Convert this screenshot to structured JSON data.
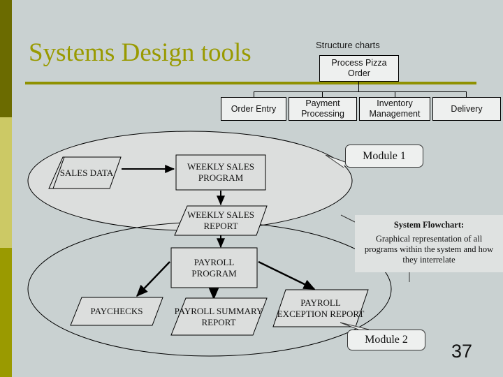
{
  "slide": {
    "title": "Systems Design tools",
    "page_number": "37",
    "background_color": "#c9d1d1",
    "title_color": "#999a00"
  },
  "sidebar": {
    "bands": [
      {
        "name": "top",
        "color": "#6b6b00"
      },
      {
        "name": "middle",
        "color": "#ccc965"
      },
      {
        "name": "bottom",
        "color": "#9a9a00"
      }
    ]
  },
  "structure_chart": {
    "label": "Structure charts",
    "root": "Process Pizza Order",
    "children": [
      {
        "label": "Order Entry"
      },
      {
        "label": "Payment Processing"
      },
      {
        "label": "Inventory Management"
      },
      {
        "label": "Delivery"
      }
    ]
  },
  "flowchart": {
    "nodes": [
      {
        "id": "sales-data",
        "shape": "parallelogram",
        "label": "SALES DATA"
      },
      {
        "id": "weekly-sales-program",
        "shape": "rectangle",
        "label": "WEEKLY SALES PROGRAM"
      },
      {
        "id": "weekly-sales-report",
        "shape": "parallelogram",
        "label": "WEEKLY SALES REPORT"
      },
      {
        "id": "payroll-program",
        "shape": "rectangle",
        "label": "PAYROLL PROGRAM"
      },
      {
        "id": "paychecks",
        "shape": "parallelogram",
        "label": "PAYCHECKS"
      },
      {
        "id": "payroll-summary-report",
        "shape": "parallelogram",
        "label": "PAYROLL SUMMARY REPORT"
      },
      {
        "id": "payroll-exception-report",
        "shape": "parallelogram",
        "label": "PAYROLL EXCEPTION REPORT"
      }
    ],
    "node_lines": {
      "sales_data": [
        "SALES",
        "DATA"
      ],
      "weekly_sales_program": [
        "WEEKLY",
        "SALES",
        "PROGRAM"
      ],
      "weekly_sales_report": [
        "WEEKLY",
        "SALES REPORT"
      ],
      "payroll_program": [
        "PAYROLL",
        "PROGRAM"
      ],
      "paychecks": [
        "PAYCHECKS"
      ],
      "payroll_summary_report": [
        "PAYROLL",
        "SUMMARY",
        "REPORT"
      ],
      "payroll_exception_report": [
        "PAYROLL",
        "EXCEPTION",
        "REPORT"
      ]
    }
  },
  "callouts": {
    "module1": "Module 1",
    "module2": "Module 2"
  },
  "description": {
    "title": "System Flowchart:",
    "body": "Graphical representation of all programs within the system and how they interrelate"
  }
}
